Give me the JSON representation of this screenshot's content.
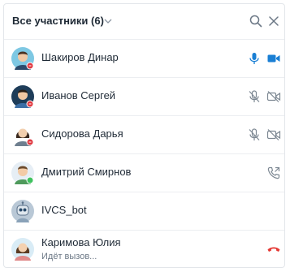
{
  "header": {
    "title": "Все участники (6)"
  },
  "participants": [
    {
      "name": "Шакиров Динар",
      "status": ""
    },
    {
      "name": "Иванов Сергей",
      "status": ""
    },
    {
      "name": "Сидорова Дарья",
      "status": ""
    },
    {
      "name": "Дмитрий Смирнов",
      "status": ""
    },
    {
      "name": "IVCS_bot",
      "status": ""
    },
    {
      "name": "Каримова Юлия",
      "status": "Идёт вызов..."
    }
  ],
  "colors": {
    "accent": "#1a7fd4",
    "muted_icon": "#7d8893",
    "online": "#3fc25f",
    "offline_badge": "#e0373f",
    "hangup": "#e53935"
  }
}
